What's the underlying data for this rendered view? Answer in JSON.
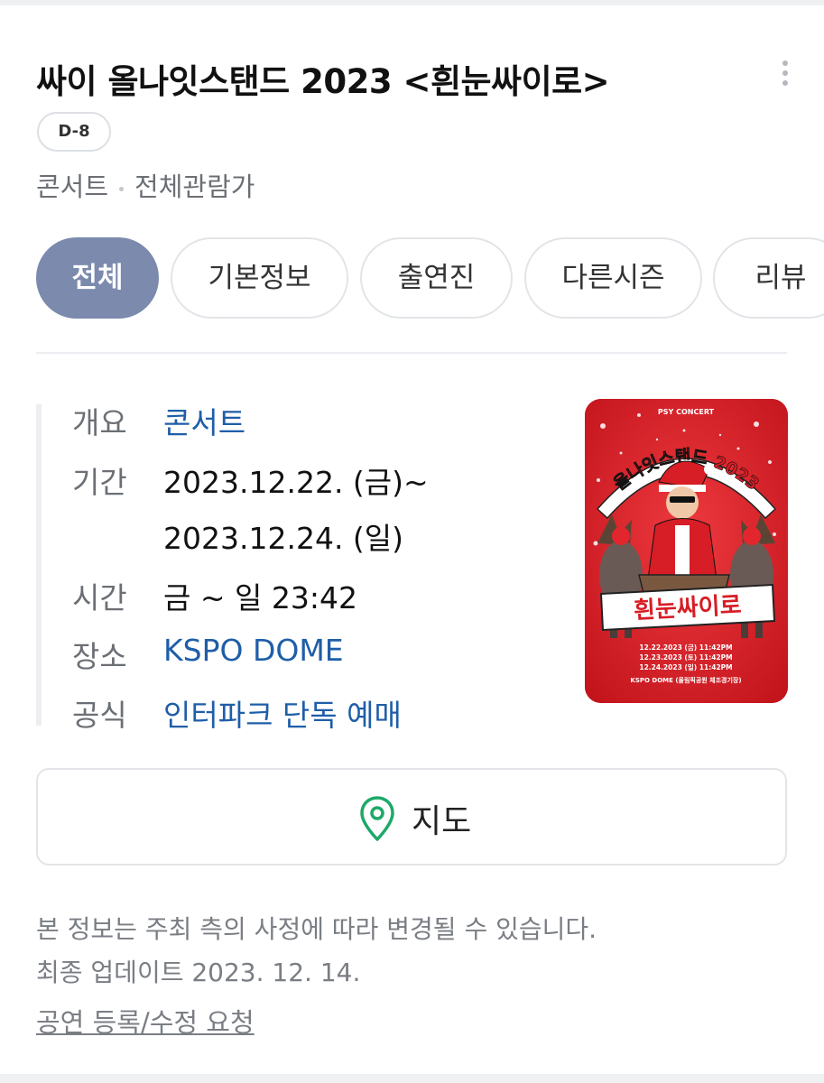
{
  "header": {
    "title": "싸이 올나잇스탠드 2023 <흰눈싸이로>",
    "dday_badge": "D-8",
    "category": "콘서트",
    "rating": "전체관람가"
  },
  "tabs": [
    {
      "label": "전체",
      "active": true
    },
    {
      "label": "기본정보",
      "active": false
    },
    {
      "label": "출연진",
      "active": false
    },
    {
      "label": "다른시즌",
      "active": false
    },
    {
      "label": "리뷰",
      "active": false
    }
  ],
  "info": {
    "overview": {
      "label": "개요",
      "value": "콘서트"
    },
    "period": {
      "label": "기간",
      "value_line1": "2023.12.22. (금)~",
      "value_line2": "2023.12.24. (일)"
    },
    "time": {
      "label": "시간",
      "value": "금 ~ 일 23:42"
    },
    "venue": {
      "label": "장소",
      "value": "KSPO DOME"
    },
    "official": {
      "label": "공식",
      "value": "인터파크 단독 예매"
    }
  },
  "poster": {
    "small_header": "PSY CONCERT",
    "arc_title": "올나잇스탠드 2023",
    "banner": "흰눈싸이로",
    "dates": [
      "12.22.2023 (금) 11:42PM",
      "12.23.2023 (토) 11:42PM",
      "12.24.2023 (일) 11:42PM"
    ],
    "venue_line": "KSPO DOME (올림픽공원 체조경기장)"
  },
  "map_button": {
    "label": "지도",
    "icon": "map-pin-icon"
  },
  "footer": {
    "notice_line1": "본 정보는 주최 측의 사정에 따라 변경될 수 있습니다.",
    "notice_line2": "최종 업데이트 2023. 12. 14.",
    "request_link": "공연 등록/수정 요청"
  },
  "colors": {
    "active_tab": "#7b8aad",
    "link": "#1f5ea8",
    "map_pin": "#1ea86a",
    "poster_red": "#d71d25"
  }
}
